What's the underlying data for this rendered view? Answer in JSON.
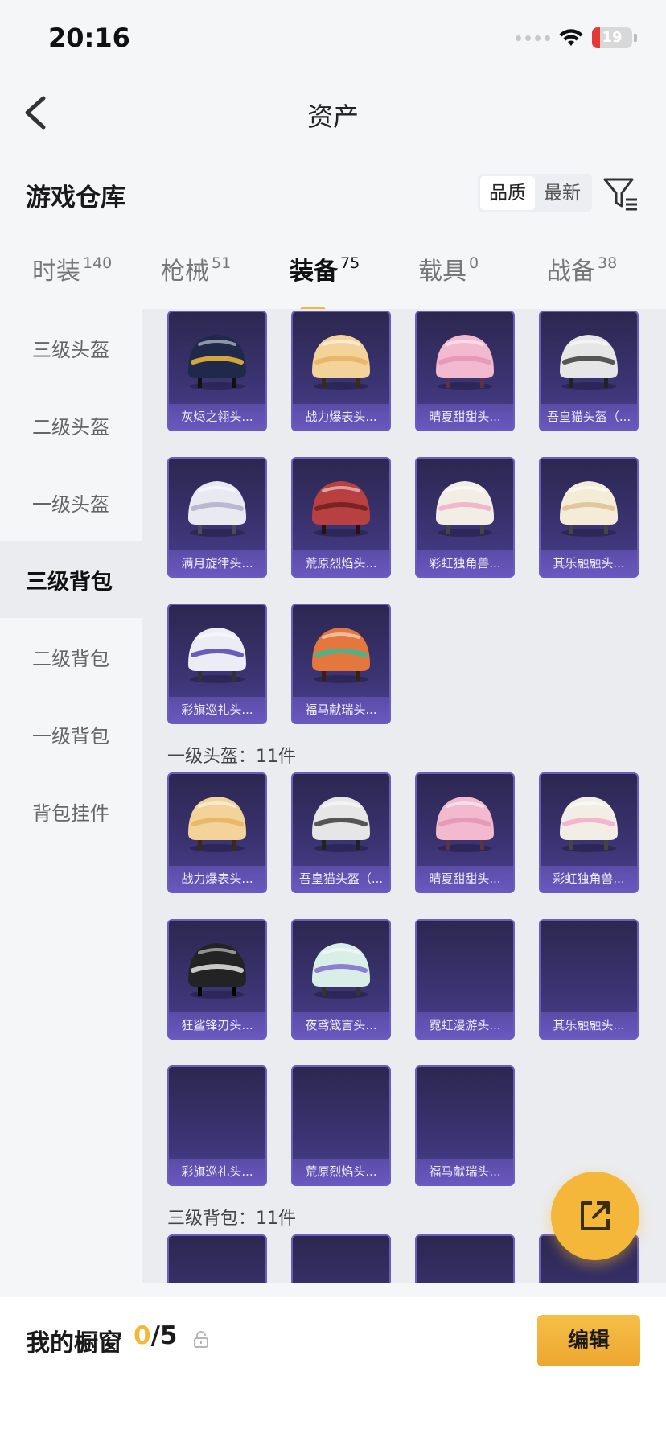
{
  "status_bar": {
    "time": "20:16",
    "battery": "19",
    "battery_level": 0.19
  },
  "nav": {
    "title": "资产"
  },
  "section": {
    "title": "游戏仓库",
    "sort_options": [
      "品质",
      "最新"
    ],
    "active_sort": 0
  },
  "tabs": [
    {
      "label": "时装",
      "count": "140"
    },
    {
      "label": "枪械",
      "count": "51"
    },
    {
      "label": "装备",
      "count": "75"
    },
    {
      "label": "载具",
      "count": "0"
    },
    {
      "label": "战备",
      "count": "38"
    }
  ],
  "active_tab": 2,
  "sidebar": {
    "items": [
      "三级头盔",
      "二级头盔",
      "一级头盔",
      "三级背包",
      "二级背包",
      "一级背包",
      "背包挂件"
    ],
    "active": 3
  },
  "groups": [
    {
      "header": "",
      "items": [
        {
          "name": "灰烬之翎头...",
          "icon": "helmet-dark-gold"
        },
        {
          "name": "战力爆表头...",
          "icon": "helmet-cream"
        },
        {
          "name": "晴夏甜甜头...",
          "icon": "helmet-pink"
        },
        {
          "name": "吾皇猫头盔（...",
          "icon": "helmet-cat"
        },
        {
          "name": "满月旋律头...",
          "icon": "helmet-white"
        },
        {
          "name": "荒原烈焰头...",
          "icon": "helmet-red"
        },
        {
          "name": "彩虹独角兽...",
          "icon": "helmet-unicorn"
        },
        {
          "name": "其乐融融头...",
          "icon": "helmet-ivory"
        },
        {
          "name": "彩旗巡礼头...",
          "icon": "helmet-white-purple"
        },
        {
          "name": "福马献瑞头...",
          "icon": "helmet-orange"
        }
      ]
    },
    {
      "header": "一级头盔：11件",
      "items": [
        {
          "name": "战力爆表头...",
          "icon": "helmet-cream"
        },
        {
          "name": "吾皇猫头盔（...",
          "icon": "helmet-cat"
        },
        {
          "name": "晴夏甜甜头...",
          "icon": "helmet-pink"
        },
        {
          "name": "彩虹独角兽...",
          "icon": "helmet-unicorn"
        },
        {
          "name": "狂鲨锋刃头...",
          "icon": "helmet-black"
        },
        {
          "name": "夜鸢箴言头...",
          "icon": "helmet-mint"
        },
        {
          "name": "霓虹漫游头...",
          "icon": ""
        },
        {
          "name": "其乐融融头...",
          "icon": ""
        },
        {
          "name": "彩旗巡礼头...",
          "icon": ""
        },
        {
          "name": "荒原烈焰头...",
          "icon": ""
        },
        {
          "name": "福马献瑞头...",
          "icon": ""
        }
      ]
    },
    {
      "header": "三级背包：11件",
      "items": [
        {
          "name": "",
          "icon": ""
        },
        {
          "name": "",
          "icon": ""
        },
        {
          "name": "",
          "icon": ""
        },
        {
          "name": "",
          "icon": ""
        }
      ]
    }
  ],
  "bottom_bar": {
    "showcase_label": "我的橱窗",
    "showcase_current": "0",
    "showcase_total": "/5",
    "edit_label": "编辑"
  },
  "colors": {
    "accent": "#f4b73a",
    "card_bg": "#3b3473",
    "card_border": "#6a5dbf"
  }
}
